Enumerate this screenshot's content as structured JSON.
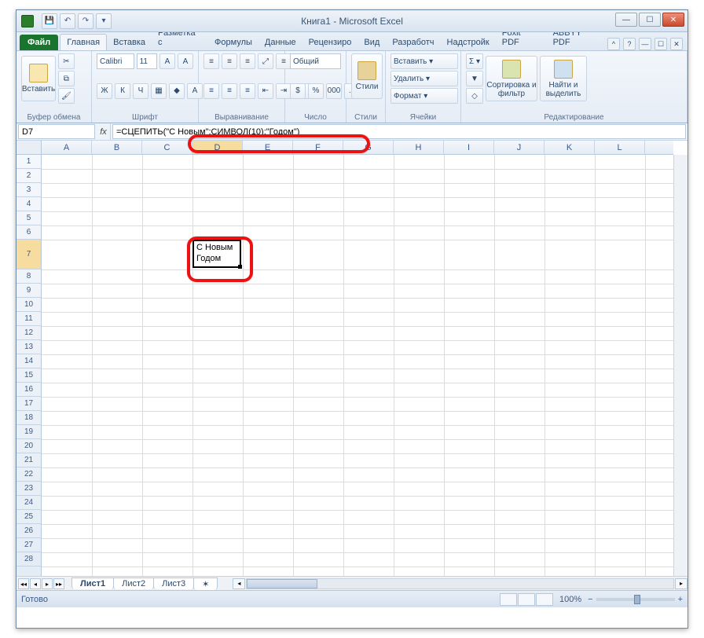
{
  "title": "Книга1 - Microsoft Excel",
  "qat": {
    "save": "💾",
    "undo": "↶",
    "redo": "↷",
    "more": "▾"
  },
  "winctrl": {
    "min": "—",
    "max": "☐",
    "close": "✕"
  },
  "tabs": {
    "file": "Файл",
    "items": [
      "Главная",
      "Вставка",
      "Разметка с",
      "Формулы",
      "Данные",
      "Рецензиро",
      "Вид",
      "Разработч",
      "Надстройк",
      "Foxit PDF",
      "ABBYY PDF"
    ],
    "active_index": 0
  },
  "ribbon": {
    "clipboard": {
      "paste": "Вставить",
      "label": "Буфер обмена",
      "cut": "✂",
      "copy": "⧉",
      "brush": "🖌"
    },
    "font": {
      "name": "Calibri",
      "size": "11",
      "label": "Шрифт",
      "bold": "Ж",
      "italic": "К",
      "under": "Ч",
      "border": "▦",
      "fill": "◆",
      "color": "A"
    },
    "align": {
      "label": "Выравнивание",
      "wrap": "≡"
    },
    "number": {
      "format": "Общий",
      "label": "Число",
      "pct": "%",
      "comma": "000"
    },
    "styles": {
      "btn": "Стили",
      "label": "Стили"
    },
    "cells": {
      "insert": "Вставить ▾",
      "delete": "Удалить ▾",
      "format": "Формат ▾",
      "label": "Ячейки"
    },
    "editing": {
      "sigma": "Σ ▾",
      "fill": "▼",
      "clear": "◇",
      "sort": "Сортировка и фильтр",
      "find": "Найти и выделить",
      "label": "Редактирование"
    }
  },
  "namebox": "D7",
  "fx_label": "fx",
  "formula": "=СЦЕПИТЬ(\"С Новым\";СИМВОЛ(10);\"Годом\")",
  "columns": [
    "A",
    "B",
    "C",
    "D",
    "E",
    "F",
    "G",
    "H",
    "I",
    "J",
    "K",
    "L"
  ],
  "rows": [
    "1",
    "2",
    "3",
    "4",
    "5",
    "6",
    "7",
    "8",
    "9",
    "10",
    "11",
    "12",
    "13",
    "14",
    "15",
    "16",
    "17",
    "18",
    "19",
    "20",
    "21",
    "22",
    "23",
    "24",
    "25",
    "26",
    "27",
    "28"
  ],
  "active_col_index": 3,
  "active_row_index": 6,
  "cell_value_line1": "С Новым",
  "cell_value_line2": "Годом",
  "sheets": [
    "Лист1",
    "Лист2",
    "Лист3"
  ],
  "active_sheet": 0,
  "status_text": "Готово",
  "zoom": "100%",
  "zoom_minus": "−",
  "zoom_plus": "+"
}
